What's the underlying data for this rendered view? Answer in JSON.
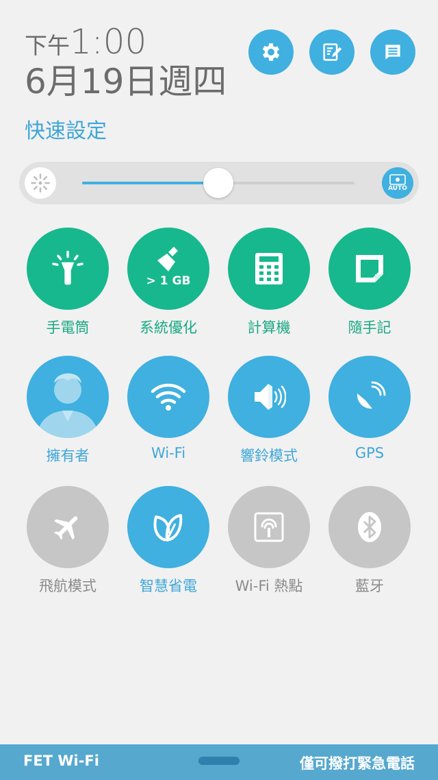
{
  "header": {
    "ampm": "下午",
    "clock": "1:00",
    "date": "6月19日週四",
    "quick_settings_title": "快速設定"
  },
  "top_buttons": [
    {
      "name": "settings",
      "icon": "gear-icon"
    },
    {
      "name": "edit",
      "icon": "edit-icon"
    },
    {
      "name": "notifications",
      "icon": "list-icon"
    }
  ],
  "brightness": {
    "level_percent": 50,
    "auto_label": "AUTO",
    "accent": "#3fb0df"
  },
  "tiles": {
    "flashlight": {
      "label": "手電筒"
    },
    "boost": {
      "label": "系統優化",
      "badge": "> 1 GB"
    },
    "calculator": {
      "label": "計算機"
    },
    "quick_memo": {
      "label": "隨手記"
    },
    "owner": {
      "label": "擁有者"
    },
    "wifi": {
      "label": "Wi-Fi"
    },
    "ring_mode": {
      "label": "響鈴模式"
    },
    "gps": {
      "label": "GPS"
    },
    "airplane": {
      "label": "飛航模式"
    },
    "smart_saving": {
      "label": "智慧省電"
    },
    "hotspot": {
      "label": "Wi-Fi 熱點"
    },
    "bluetooth": {
      "label": "藍牙"
    }
  },
  "colors": {
    "green": "#17b88d",
    "blue": "#3fb0df",
    "gray": "#c6c6c6"
  },
  "status_bar": {
    "carrier": "FET Wi-Fi",
    "emergency": "僅可撥打緊急電話"
  }
}
